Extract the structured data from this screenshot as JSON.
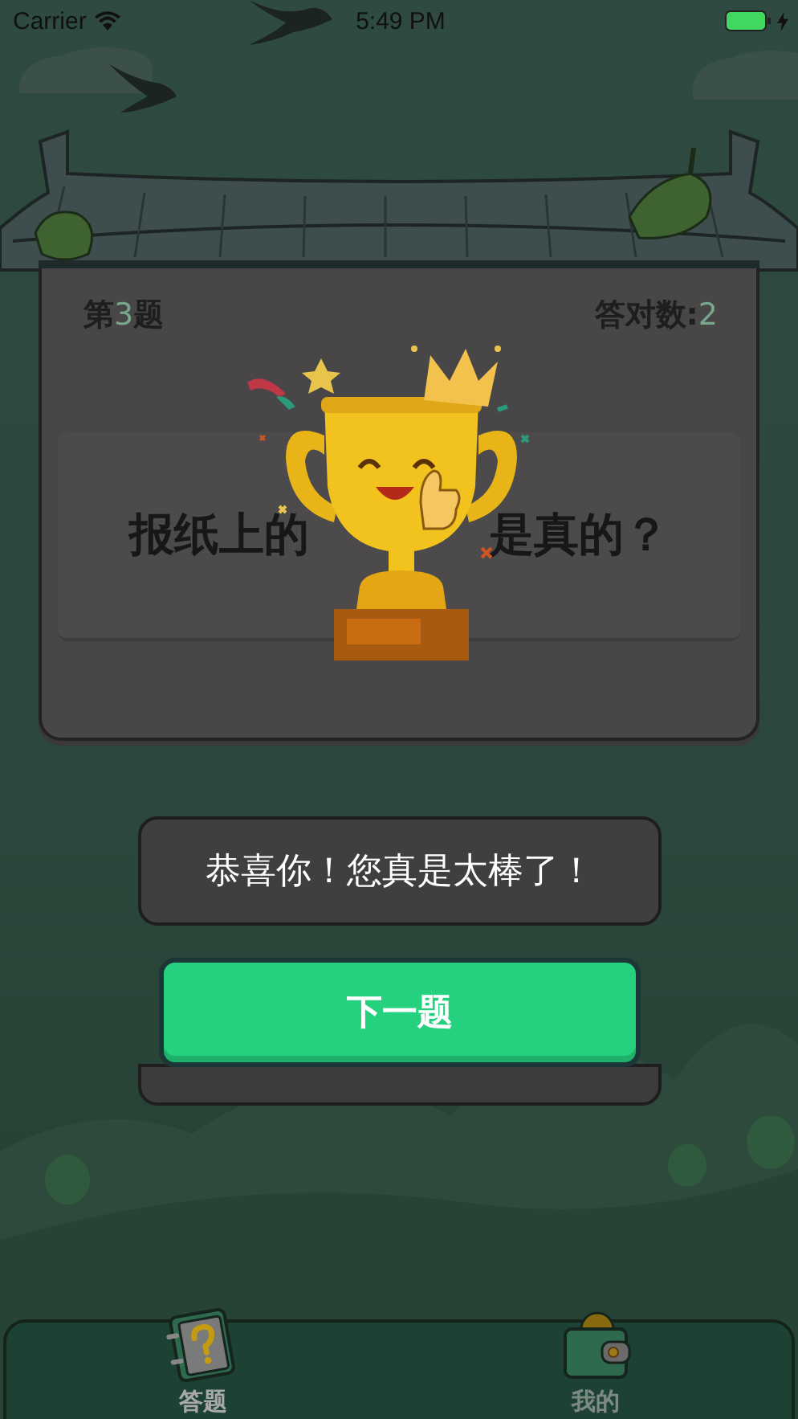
{
  "status_bar": {
    "carrier": "Carrier",
    "time": "5:49 PM"
  },
  "quiz": {
    "counter": {
      "prefix": "第",
      "number": "3",
      "suffix": "题"
    },
    "score": {
      "label": "答对数:",
      "value": "2"
    },
    "question": {
      "visible_start": "报纸上的",
      "visible_end": "是真的？"
    }
  },
  "dialog": {
    "message": "恭喜你！您真是太棒了！",
    "button": "下一题"
  },
  "tabs": [
    {
      "label": "答题",
      "selected": true,
      "kind": "quiz"
    },
    {
      "label": "我的",
      "selected": false,
      "kind": "wallet"
    }
  ]
}
